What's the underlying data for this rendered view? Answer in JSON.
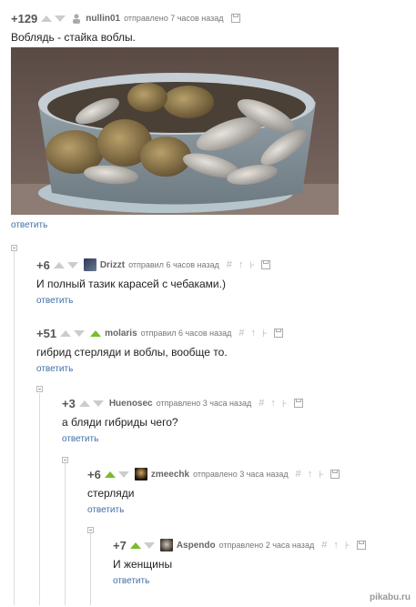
{
  "reply_label": "ответить",
  "comments": [
    {
      "rating": "+129",
      "user": "nullin01",
      "meta": "отправлено 7 часов назад",
      "text": "Воблядь - стайка воблы."
    },
    {
      "rating": "+6",
      "user": "Drizzt",
      "meta": "отправил 6 часов назад",
      "text": "И полный тазик карасей с чебаками.)"
    },
    {
      "rating": "+51",
      "user": "molaris",
      "meta": "отправил 6 часов назад",
      "text": "гибрид стерляди и воблы, вообще то."
    },
    {
      "rating": "+3",
      "user": "Huenosec",
      "meta": "отправлено 3 часа назад",
      "text": "а бляди гибриды чего?"
    },
    {
      "rating": "+6",
      "user": "zmeechk",
      "meta": "отправлено 3 часа назад",
      "text": "стерляди"
    },
    {
      "rating": "+7",
      "user": "Aspendo",
      "meta": "отправлено 2 часа назад",
      "text": "И женщины"
    }
  ],
  "watermark": "pikabu.ru",
  "colors": {
    "vote_up_active": "#7cbb2b",
    "link": "#3f6fa8"
  }
}
